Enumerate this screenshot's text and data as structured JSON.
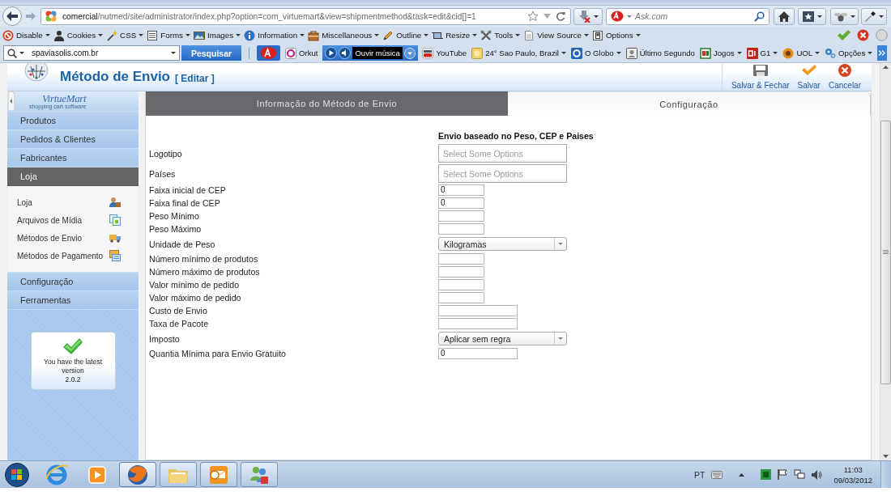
{
  "browser": {
    "address_bar": {
      "host": "comercial",
      "path": "/nutmed/site/administrator/index.php?option=com_virtuemart&view=shipmentmethod&task=edit&cid[]=1"
    },
    "search_field": {
      "placeholder": "Ask.com"
    },
    "developer_toolbar": {
      "menus": [
        "Disable",
        "Cookies",
        "CSS",
        "Forms",
        "Images",
        "Information",
        "Miscellaneous",
        "Outline",
        "Resize",
        "Tools",
        "View Source",
        "Options"
      ]
    },
    "search_toolbar": {
      "search_value": "spaviasolis.com.br",
      "search_button": "Pesquisar",
      "items": [
        {
          "kind": "link",
          "label": "Orkut",
          "has_menu": false
        },
        {
          "kind": "player",
          "label": "Ouvir música"
        },
        {
          "kind": "link",
          "label": "YouTube",
          "has_menu": false
        },
        {
          "kind": "link",
          "label": "24° Sao Paulo, Brazil",
          "has_menu": true
        },
        {
          "kind": "link",
          "label": "O Globo",
          "has_menu": true
        },
        {
          "kind": "link",
          "label": "Último Segundo",
          "has_menu": false
        },
        {
          "kind": "link",
          "label": "Jogos",
          "has_menu": true
        },
        {
          "kind": "link",
          "label": "G1",
          "has_menu": true
        },
        {
          "kind": "link",
          "label": "UOL",
          "has_menu": true
        },
        {
          "kind": "link",
          "label": "Opções",
          "has_menu": true
        }
      ]
    }
  },
  "admin": {
    "header": {
      "title": "Método de Envio",
      "subtitle": "[ Editar ]",
      "actions": [
        {
          "label": "Salvar & Fechar"
        },
        {
          "label": "Salvar"
        },
        {
          "label": "Cancelar"
        }
      ]
    },
    "sidebar": {
      "logo": "VirtueMart",
      "logo_tagline": "shopping cart software",
      "items": [
        {
          "label": "Produtos",
          "expanded": false
        },
        {
          "label": "Pedidos & Clientes",
          "expanded": false
        },
        {
          "label": "Fabricantes",
          "expanded": false
        },
        {
          "label": "Loja",
          "expanded": true,
          "children": [
            {
              "label": "Loja"
            },
            {
              "label": "Arquivos de Mídia"
            },
            {
              "label": "Métodos de Envio"
            },
            {
              "label": "Métodos de Pagamento"
            }
          ]
        },
        {
          "label": "Configuração",
          "expanded": false
        },
        {
          "label": "Ferramentas",
          "expanded": false
        }
      ],
      "version_box": {
        "message": "You have the latest version",
        "version": "2.0.2"
      }
    },
    "tabs": [
      {
        "label": "Informação do Método de Envio",
        "selected": false
      },
      {
        "label": "Configuração",
        "selected": true
      }
    ],
    "form": {
      "heading": "Envio baseado no Peso, CEP e Paises",
      "fields": [
        {
          "label": "Logotipo",
          "kind": "multiselect",
          "placeholder": "Select Some Options"
        },
        {
          "label": "Países",
          "kind": "multiselect",
          "placeholder": "Select Some Options"
        },
        {
          "label": "Faixa inicial de CEP",
          "kind": "text",
          "value": "0"
        },
        {
          "label": "Faixa final de CEP",
          "kind": "text",
          "value": "0"
        },
        {
          "label": "Peso Mínimo",
          "kind": "text"
        },
        {
          "label": "Peso Máximo",
          "kind": "text"
        },
        {
          "label": "Unidade de Peso",
          "kind": "select",
          "value": "Kilogramas"
        },
        {
          "label": "Número mínimo de produtos",
          "kind": "text"
        },
        {
          "label": "Número máximo de produtos",
          "kind": "text"
        },
        {
          "label": "Valor mínimo de pedido",
          "kind": "text"
        },
        {
          "label": "Valor máximo de pedido",
          "kind": "text"
        },
        {
          "label": "Custo de Envio",
          "kind": "money"
        },
        {
          "label": "Taxa de Pacote",
          "kind": "money"
        },
        {
          "label": "Imposto",
          "kind": "select",
          "value": "Aplicar sem regra"
        },
        {
          "label": "Quantia Mínima para Envio Gratuito",
          "kind": "money",
          "value": "0"
        }
      ]
    }
  },
  "taskbar": {
    "apps": [
      {
        "running": false,
        "active": false
      },
      {
        "running": false,
        "active": false
      },
      {
        "running": true,
        "active": true
      },
      {
        "running": true,
        "active": false
      },
      {
        "running": true,
        "active": false
      },
      {
        "running": true,
        "active": false
      }
    ],
    "tray": {
      "language": "PT",
      "time": "11:03",
      "date": "09/03/2012"
    }
  }
}
